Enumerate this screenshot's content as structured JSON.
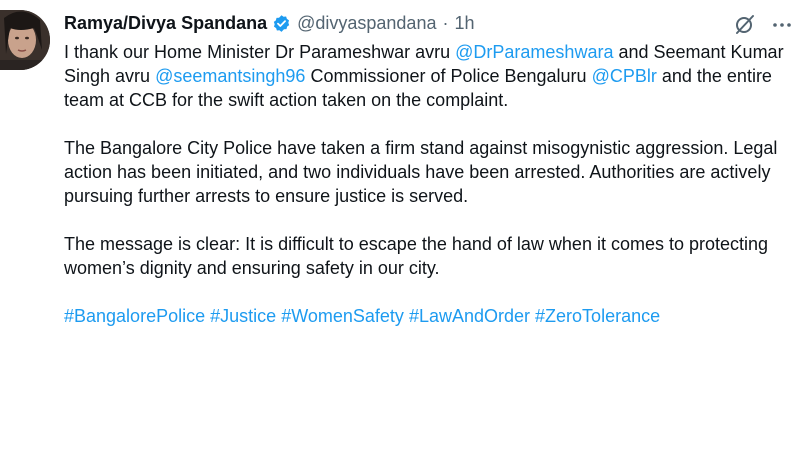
{
  "author": {
    "display_name": "Ramya/Divya Spandana",
    "handle": "@divyaspandana",
    "separator": "·",
    "time": "1h"
  },
  "icons": {
    "verified": "verified-badge-icon",
    "grok": "grok-icon",
    "more": "more-options-icon"
  },
  "colors": {
    "link": "#1d9bf0",
    "verified": "#1d9bf0",
    "text": "#0f1419",
    "muted": "#536471"
  },
  "tweet": {
    "p1": {
      "t1": "I thank our Home Minister  Dr Parameshwar avru ",
      "m1": "@DrParameshwara",
      "t2": " and Seemant Kumar Singh avru ",
      "m2": "@seemantsingh96",
      "t3": " Commissioner of Police Bengaluru ",
      "m3": "@CPBlr",
      "t4": " and the entire team at CCB for the swift action taken on the complaint."
    },
    "p2": "The Bangalore City Police have taken a firm stand against misogynistic aggression. Legal action has been initiated, and two individuals have been arrested. Authorities are actively pursuing further arrests to ensure justice is served.",
    "p3": "The message is clear: It is difficult to escape the hand of law when it comes to protecting women’s dignity and ensuring safety in our city.",
    "hashtags": [
      "#BangalorePolice",
      "#Justice",
      "#WomenSafety",
      "#LawAndOrder",
      "#ZeroTolerance"
    ]
  }
}
